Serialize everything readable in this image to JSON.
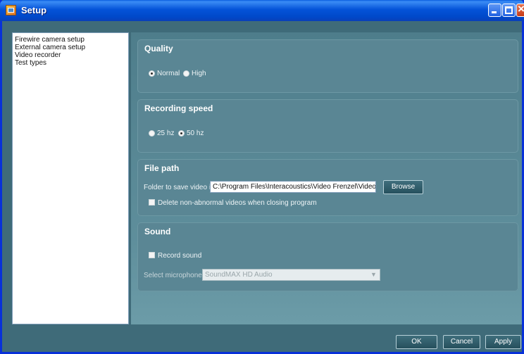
{
  "window": {
    "title": "Setup"
  },
  "sidebar": {
    "items": [
      {
        "label": "Firewire camera setup"
      },
      {
        "label": "External camera setup"
      },
      {
        "label": "Video recorder"
      },
      {
        "label": "Test types"
      }
    ]
  },
  "quality": {
    "title": "Quality",
    "options": [
      {
        "label": "Normal",
        "selected": true
      },
      {
        "label": "High",
        "selected": false
      }
    ]
  },
  "recording_speed": {
    "title": "Recording speed",
    "options": [
      {
        "label": "25 hz",
        "selected": false
      },
      {
        "label": "50 hz",
        "selected": true
      }
    ]
  },
  "file_path": {
    "title": "File path",
    "folder_label": "Folder to save video in:",
    "folder_value": "C:\\Program Files\\Interacoustics\\Video Frenzel\\Video",
    "browse_label": "Browse",
    "delete_label": "Delete non-abnormal videos when closing program",
    "delete_checked": false
  },
  "sound": {
    "title": "Sound",
    "record_label": "Record sound",
    "record_checked": false,
    "microphone_label": "Select microphone",
    "microphone_value": "SoundMAX HD Audio"
  },
  "footer": {
    "ok_label": "OK",
    "cancel_label": "Cancel",
    "apply_label": "Apply"
  },
  "colors": {
    "background": "#3f6b79",
    "group": "#5a8694",
    "titlebar": "#0453d8"
  }
}
